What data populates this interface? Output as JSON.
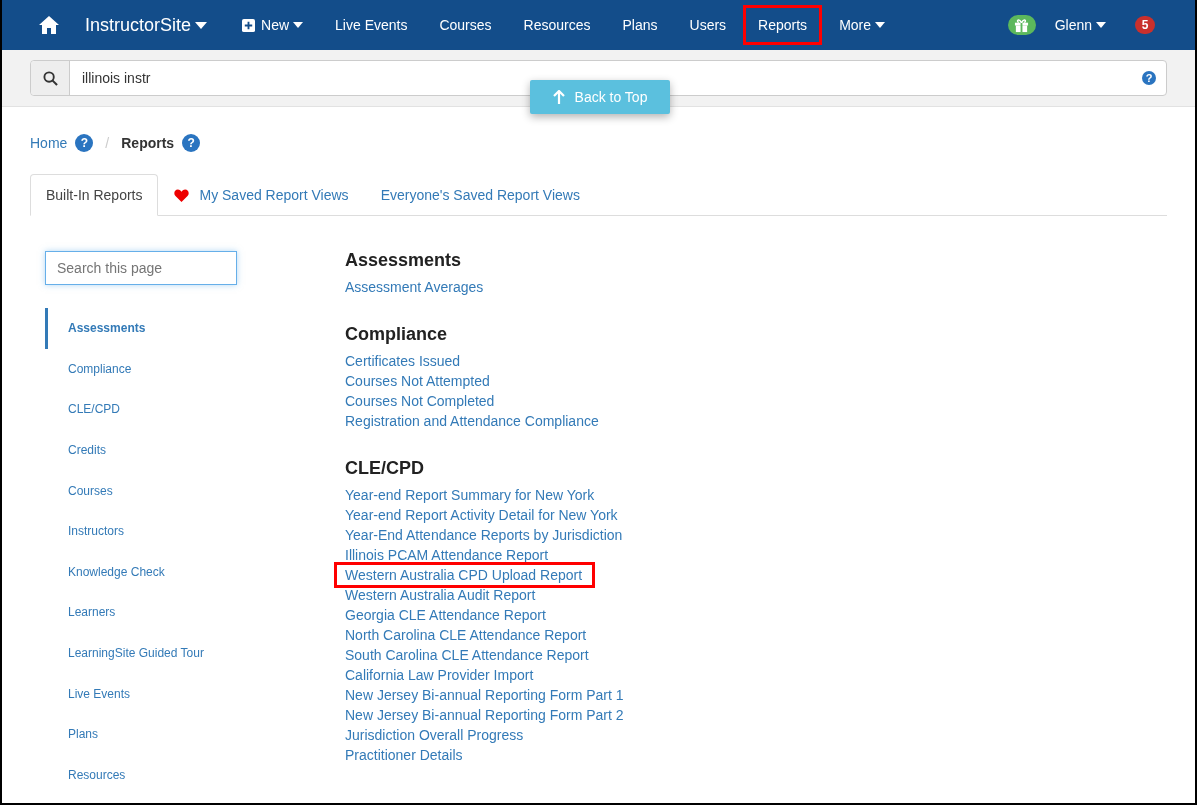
{
  "navbar": {
    "brand": "InstructorSite",
    "items": [
      {
        "label": "New",
        "kind": "new",
        "highlighted": false
      },
      {
        "label": "Live Events",
        "kind": "link",
        "highlighted": false
      },
      {
        "label": "Courses",
        "kind": "link",
        "highlighted": false
      },
      {
        "label": "Resources",
        "kind": "link",
        "highlighted": false
      },
      {
        "label": "Plans",
        "kind": "link",
        "highlighted": false
      },
      {
        "label": "Users",
        "kind": "link",
        "highlighted": false
      },
      {
        "label": "Reports",
        "kind": "link",
        "highlighted": true
      },
      {
        "label": "More",
        "kind": "dropdown",
        "highlighted": false
      }
    ],
    "user": "Glenn",
    "notification_count": "5"
  },
  "search": {
    "value": "illinois instr",
    "help": "?"
  },
  "back_to_top": "Back to Top",
  "breadcrumb": [
    {
      "label": "Home",
      "current": false,
      "help": "?"
    },
    {
      "separator": "/",
      "label": "Reports",
      "current": true,
      "help": "?"
    }
  ],
  "tabs": [
    {
      "label": "Built-In Reports",
      "selected": true,
      "favorite": false
    },
    {
      "label": "My Saved Report Views",
      "selected": false,
      "favorite": true
    },
    {
      "label": "Everyone's Saved Report Views",
      "selected": false,
      "favorite": false
    }
  ],
  "page_search": {
    "placeholder": "Search this page"
  },
  "sidebar": {
    "items": [
      {
        "label": "Assessments",
        "selected": true
      },
      {
        "label": "Compliance",
        "selected": false
      },
      {
        "label": "CLE/CPD",
        "selected": false
      },
      {
        "label": "Credits",
        "selected": false
      },
      {
        "label": "Courses",
        "selected": false
      },
      {
        "label": "Instructors",
        "selected": false
      },
      {
        "label": "Knowledge Check",
        "selected": false
      },
      {
        "label": "Learners",
        "selected": false
      },
      {
        "label": "LearningSite Guided Tour",
        "selected": false
      },
      {
        "label": "Live Events",
        "selected": false
      },
      {
        "label": "Plans",
        "selected": false
      },
      {
        "label": "Resources",
        "selected": false
      }
    ]
  },
  "sections": [
    {
      "title": "Assessments",
      "reports": [
        {
          "label": "Assessment Averages",
          "highlighted": false
        }
      ]
    },
    {
      "title": "Compliance",
      "reports": [
        {
          "label": "Certificates Issued",
          "highlighted": false
        },
        {
          "label": "Courses Not Attempted",
          "highlighted": false
        },
        {
          "label": "Courses Not Completed",
          "highlighted": false
        },
        {
          "label": "Registration and Attendance Compliance",
          "highlighted": false
        }
      ]
    },
    {
      "title": "CLE/CPD",
      "reports": [
        {
          "label": "Year-end Report Summary for New York",
          "highlighted": false
        },
        {
          "label": "Year-end Report Activity Detail for New York",
          "highlighted": false
        },
        {
          "label": "Year-End Attendance Reports by Jurisdiction",
          "highlighted": false
        },
        {
          "label": "Illinois PCAM Attendance Report",
          "highlighted": false
        },
        {
          "label": "Western Australia CPD Upload Report",
          "highlighted": true
        },
        {
          "label": "Western Australia Audit Report",
          "highlighted": false
        },
        {
          "label": "Georgia CLE Attendance Report",
          "highlighted": false
        },
        {
          "label": "North Carolina CLE Attendance Report",
          "highlighted": false
        },
        {
          "label": "South Carolina CLE Attendance Report",
          "highlighted": false
        },
        {
          "label": "California Law Provider Import",
          "highlighted": false
        },
        {
          "label": "New Jersey Bi-annual Reporting Form Part 1",
          "highlighted": false
        },
        {
          "label": "New Jersey Bi-annual Reporting Form Part 2",
          "highlighted": false
        },
        {
          "label": "Jurisdiction Overall Progress",
          "highlighted": false
        },
        {
          "label": "Practitioner Details",
          "highlighted": false
        }
      ]
    }
  ]
}
